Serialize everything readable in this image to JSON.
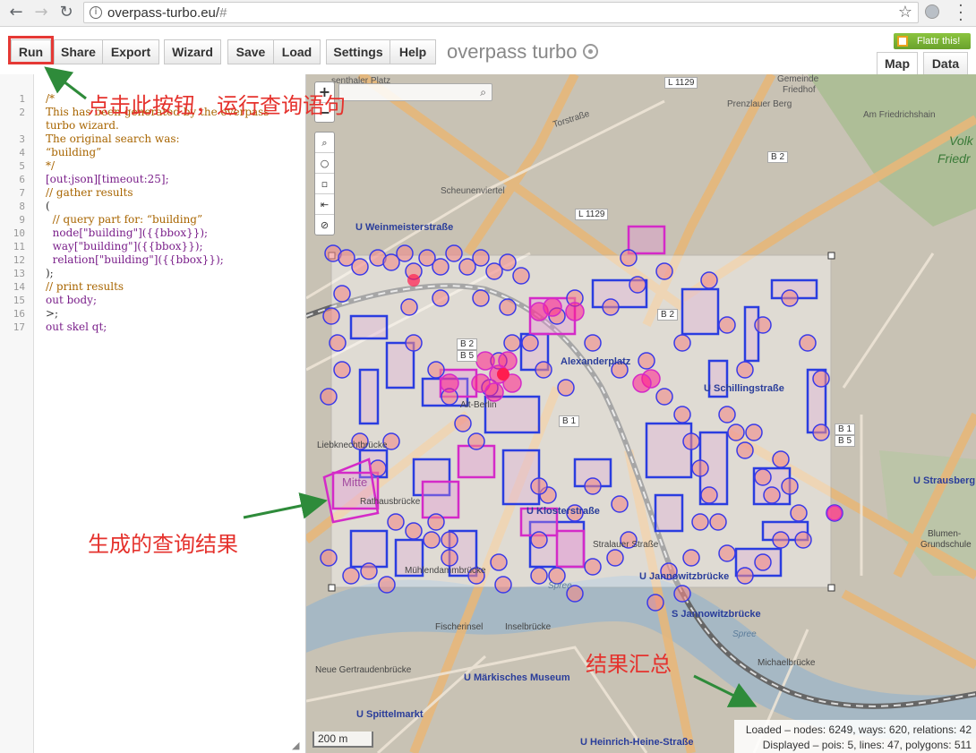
{
  "browser": {
    "url_host": "overpass-turbo.eu/",
    "url_hash": "#"
  },
  "toolbar": {
    "buttons": [
      "Run",
      "Share",
      "Export",
      "Wizard",
      "Save",
      "Load",
      "Settings",
      "Help"
    ],
    "title": "overpass turbo",
    "flattr": "Flattr this!",
    "tabs": {
      "map": "Map",
      "data": "Data"
    }
  },
  "editor": {
    "lines": [
      "/*",
      "This has been generated by the overpass",
      "turbo wizard.",
      "The original search was:",
      "“building”",
      "*/",
      "[out:json][timeout:25];",
      "// gather results",
      "(",
      "  // query part for: “building”",
      "  node[\"building\"]({{bbox}});",
      "  way[\"building\"]({{bbox}});",
      "  relation[\"building\"]({{bbox}});",
      ");",
      "// print results",
      "out body;",
      ">;",
      "out skel qt;"
    ],
    "line_numbers": [
      "1",
      "2",
      "",
      "3",
      "4",
      "5",
      "6",
      "7",
      "8",
      "9",
      "10",
      "11",
      "12",
      "13",
      "14",
      "15",
      "16",
      "17"
    ]
  },
  "map": {
    "scale": "200 m",
    "stats_loaded": "Loaded – nodes: 6249, ways: 620, relations: 42",
    "stats_displayed": "Displayed – pois: 5, lines: 47, polygons: 511",
    "labels": {
      "platz": "senthaler Platz",
      "l1129a": "L 1129",
      "gemeinde1": "Gemeinde",
      "gemeinde2": "Friedhof",
      "prenz": "Prenzlauer Berg",
      "torstr": "Torstraße",
      "amfried": "Am Friedrichshain",
      "volk1": "Volk",
      "volk2": "Friedr",
      "b2a": "B 2",
      "l1129b": "L 1129",
      "weinm": "U Weinmeisterstraße",
      "scheunen": "Scheunenviertel",
      "b2b": "B 2",
      "b2c": "B 2",
      "b5a": "B 5",
      "alexplatz": "Alexanderplatz",
      "schilling": "U Schillingstraße",
      "altberlin": "Alt-Berlin",
      "b1a": "B 1",
      "b1b": "B 1",
      "b5b": "B 5",
      "lieb": "Liebknechtbrücke",
      "mitte": "Mitte",
      "rathaus": "Rathausbrücke",
      "klost": "U Klosterstraße",
      "stral": "Stralauer Straße",
      "muehl": "Mühlendammbrücke",
      "jann": "U Jannowitzbrücke",
      "sjann": "S Jannowitzbrücke",
      "strausberg": "U Strausberg",
      "blumen1": "Blumen-",
      "blumen2": "Grundschule",
      "fischer": "Fischerinsel",
      "insel": "Inselbrücke",
      "neuger": "Neue Gertraudenbrücke",
      "maerk": "U Märkisches Museum",
      "michael": "Michaelbrücke",
      "spittel": "U Spittelmarkt",
      "heine": "U Heinrich-Heine-Straße",
      "spree1": "Spree",
      "spree2": "Spree"
    }
  },
  "annotations": {
    "run": "点击此按钮，运行查询语句",
    "result": "生成的查询结果",
    "summary": "结果汇总"
  }
}
